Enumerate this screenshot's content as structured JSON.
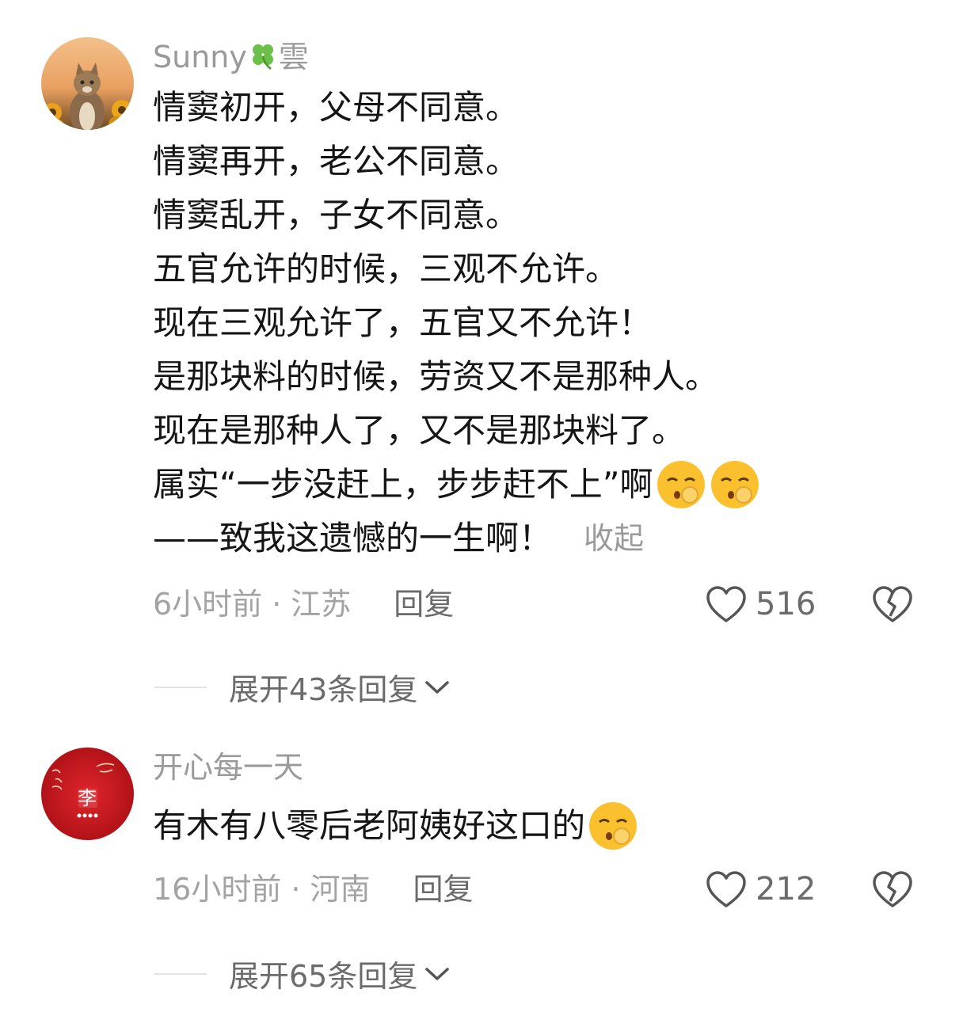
{
  "comments": [
    {
      "username": "Sunny",
      "username_emoji": "🍀",
      "username_suffix": "雲",
      "lines": [
        "情窦初开，父母不同意。",
        "情窦再开，老公不同意。",
        "情窦乱开，子女不同意。",
        "五官允许的时候，三观不允许。",
        "现在三观允许了，五官又不允许！",
        "是那块料的时候，劳资又不是那种人。",
        "现在是那种人了，又不是那块料了。",
        "属实“一步没赶上，步步赶不上”啊",
        "——致我这遗憾的一生啊！"
      ],
      "collapse_label": "收起",
      "time": "6小时前",
      "location": "江苏",
      "reply_label": "回复",
      "likes": "516",
      "expand_label": "展开43条回复"
    },
    {
      "username": "开心每一天",
      "avatar_text": "李",
      "lines": [
        "有木有八零后老阿姨好这口的"
      ],
      "time": "16小时前",
      "location": "河南",
      "reply_label": "回复",
      "likes": "212",
      "expand_label": "展开65条回复"
    }
  ],
  "separator": "·",
  "colors": {
    "secondary_text": "#9a9a9a",
    "action_text": "#6b6b6b",
    "avatar2_red": "#c8161d"
  }
}
